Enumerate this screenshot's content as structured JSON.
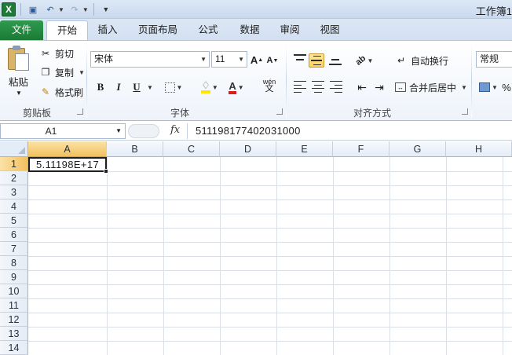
{
  "window": {
    "title": "工作簿1"
  },
  "tabs": [
    "文件",
    "开始",
    "插入",
    "页面布局",
    "公式",
    "数据",
    "审阅",
    "视图"
  ],
  "active_tab": "开始",
  "ribbon": {
    "clipboard": {
      "paste": "粘贴",
      "cut": "剪切",
      "copy": "复制",
      "format_painter": "格式刷",
      "group": "剪贴板"
    },
    "font": {
      "name": "宋体",
      "size": "11",
      "bold": "B",
      "italic": "I",
      "underline": "U",
      "phonetic": "wén",
      "group": "字体"
    },
    "alignment": {
      "wrap": "自动换行",
      "merge": "合并后居中",
      "group": "对齐方式"
    },
    "number": {
      "format": "常规"
    }
  },
  "formula_bar": {
    "name_box": "A1",
    "fx": "fx",
    "content": "511198177402031000"
  },
  "grid": {
    "columns": [
      "A",
      "B",
      "C",
      "D",
      "E",
      "F",
      "G",
      "H"
    ],
    "rows": [
      "1",
      "2",
      "3",
      "4",
      "5",
      "6",
      "7",
      "8",
      "9",
      "10",
      "11",
      "12",
      "13",
      "14"
    ],
    "cells": {
      "A1": "5.11198E+17"
    }
  },
  "colors": {
    "file_tab": "#1c7a36",
    "selection_header": "#f1c15f",
    "ribbon_border": "#b3c5dc"
  }
}
